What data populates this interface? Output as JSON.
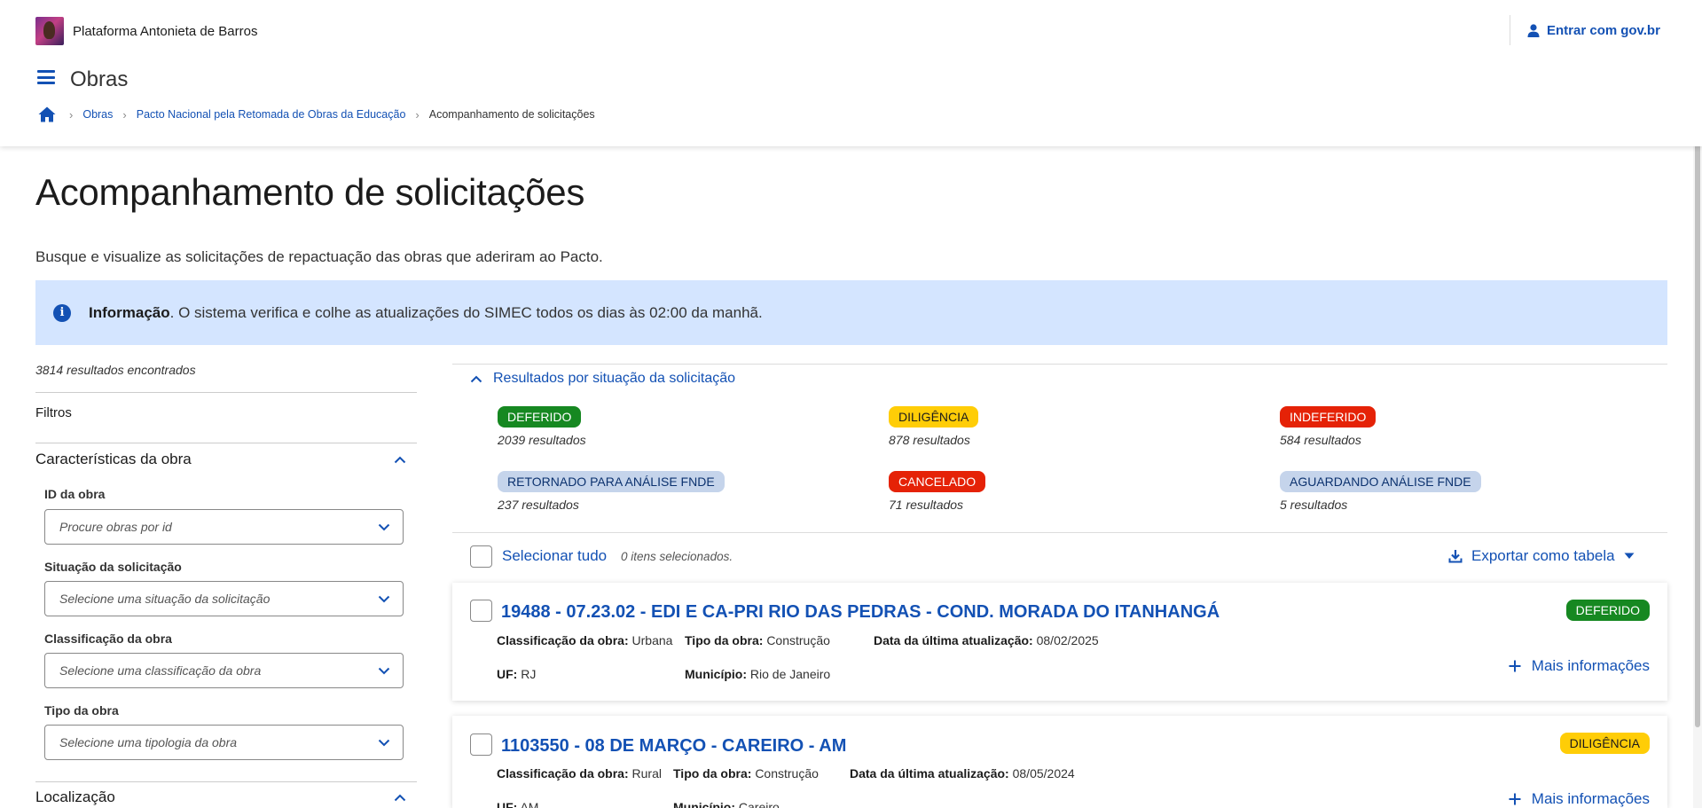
{
  "header": {
    "platform_name": "Plataforma Antonieta de Barros",
    "login_prefix": "Entrar com",
    "login_brand": "gov.br",
    "app_title": "Obras"
  },
  "breadcrumb": {
    "items": [
      "Obras",
      "Pacto Nacional pela Retomada de Obras da Educação"
    ],
    "current": "Acompanhamento de solicitações"
  },
  "page": {
    "title": "Acompanhamento de solicitações",
    "description": "Busque e visualize as solicitações de repactuação das obras que aderiram ao Pacto."
  },
  "info": {
    "label": "Informação",
    "text": ". O sistema verifica e colhe as atualizações do SIMEC todos os dias às 02:00 da manhã."
  },
  "sidebar": {
    "result_count": "3814 resultados encontrados",
    "filters_label": "Filtros",
    "section_characteristics": "Características da obra",
    "fields": [
      {
        "label": "ID da obra",
        "placeholder": "Procure obras por id"
      },
      {
        "label": "Situação da solicitação",
        "placeholder": "Selecione uma situação da solicitação"
      },
      {
        "label": "Classificação da obra",
        "placeholder": "Selecione uma classificação da obra"
      },
      {
        "label": "Tipo da obra",
        "placeholder": "Selecione uma tipologia da obra"
      }
    ],
    "section_location": "Localização"
  },
  "status_summary": {
    "toggle_label": "Resultados por situação da solicitação",
    "items": [
      {
        "label": "DEFERIDO",
        "count": "2039 resultados",
        "bg": "#168821",
        "fg": "#ffffff"
      },
      {
        "label": "DILIGÊNCIA",
        "count": "878 resultados",
        "bg": "#ffcd07",
        "fg": "#1b1b1b"
      },
      {
        "label": "INDEFERIDO",
        "count": "584 resultados",
        "bg": "#e52207",
        "fg": "#ffffff"
      },
      {
        "label": "RETORNADO PARA ANÁLISE FNDE",
        "count": "237 resultados",
        "bg": "#c5d4eb",
        "fg": "#0c326f"
      },
      {
        "label": "CANCELADO",
        "count": "71 resultados",
        "bg": "#e52207",
        "fg": "#ffffff"
      },
      {
        "label": "AGUARDANDO ANÁLISE FNDE",
        "count": "5 resultados",
        "bg": "#c5d4eb",
        "fg": "#0c326f"
      }
    ]
  },
  "list_toolbar": {
    "select_all": "Selecionar tudo",
    "selected_count": "0 itens selecionados.",
    "export": "Exportar como tabela"
  },
  "cards": [
    {
      "title": "19488 - 07.23.02 - EDI E CA-PRI RIO DAS PEDRAS - COND. MORADA DO ITANHANGÁ",
      "status": "DEFERIDO",
      "status_bg": "#168821",
      "status_fg": "#ffffff",
      "classificacao_label": "Classificação da obra:",
      "classificacao": "Urbana",
      "tipo_label": "Tipo da obra:",
      "tipo": "Construção",
      "data_label": "Data da última atualização:",
      "data": "08/02/2025",
      "uf_label": "UF:",
      "uf": "RJ",
      "municipio_label": "Município:",
      "municipio": "Rio de Janeiro",
      "more": "Mais informações"
    },
    {
      "title": "1103550 - 08 DE MARÇO - CAREIRO - AM",
      "status": "DILIGÊNCIA",
      "status_bg": "#ffcd07",
      "status_fg": "#1b1b1b",
      "classificacao_label": "Classificação da obra:",
      "classificacao": "Rural",
      "tipo_label": "Tipo da obra:",
      "tipo": "Construção",
      "data_label": "Data da última atualização:",
      "data": "08/05/2024",
      "uf_label": "UF:",
      "uf": "AM",
      "municipio_label": "Município:",
      "municipio": "Careiro",
      "more": "Mais informações"
    }
  ]
}
